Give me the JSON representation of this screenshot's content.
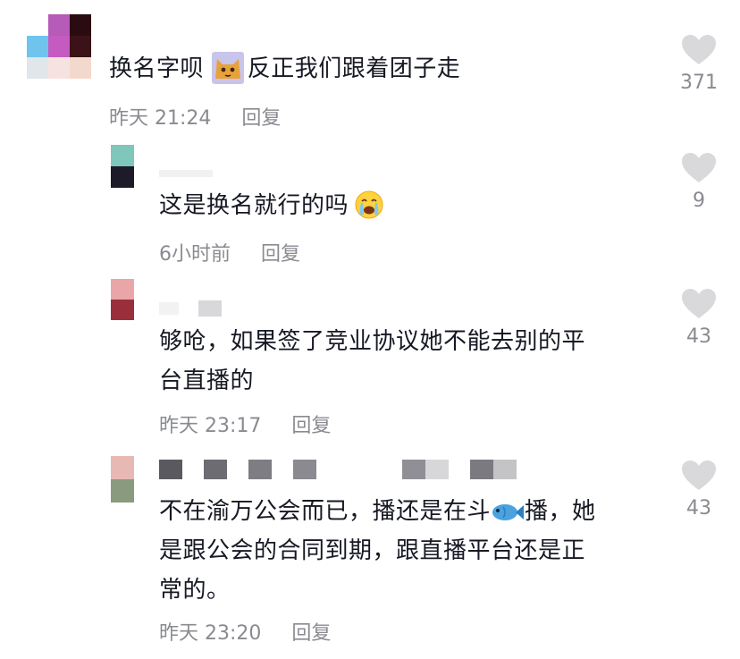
{
  "comments": [
    {
      "text_lines": [
        "换名字呗 ",
        "反正我们跟着团子走"
      ],
      "emoji": "cat-face-emoji",
      "time": "昨天 21:24",
      "reply_label": "回复",
      "likes": "371"
    },
    {
      "text_lines": [
        "这是换名就行的吗"
      ],
      "emoji": "crying-face-emoji",
      "time": "6小时前",
      "reply_label": "回复",
      "likes": "9"
    },
    {
      "text_lines": [
        "够呛，如果签了竞业协议她不能去别的平",
        "台直播的"
      ],
      "time": "昨天 23:17",
      "reply_label": "回复",
      "likes": "43"
    },
    {
      "text_lines": [
        "不在渝万公会而已，播还是在斗",
        "播，她",
        "是跟公会的合同到期，跟直播平台还是正",
        "常的。"
      ],
      "emoji": "fish-emoji",
      "time": "昨天 23:20",
      "reply_label": "回复",
      "likes": "43"
    }
  ],
  "colors": {
    "text": "#161823",
    "meta": "#8a8b91",
    "heart": "#d9d9db"
  },
  "icons": [
    "heart-icon"
  ]
}
